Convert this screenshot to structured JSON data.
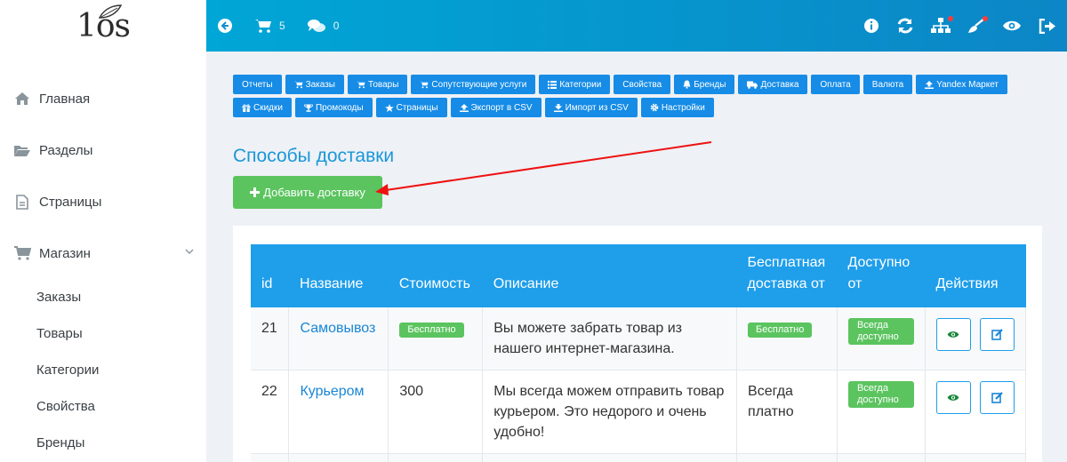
{
  "logo": {
    "text": "1os"
  },
  "topbar": {
    "cart_count": "5",
    "comments_count": "0"
  },
  "sidebar": {
    "items": [
      {
        "label": "Главная",
        "icon": "home-icon"
      },
      {
        "label": "Разделы",
        "icon": "folder-open-icon"
      },
      {
        "label": "Страницы",
        "icon": "file-icon"
      },
      {
        "label": "Магазин",
        "icon": "cart-icon"
      }
    ],
    "subitems": [
      "Заказы",
      "Товары",
      "Категории",
      "Свойства",
      "Бренды"
    ]
  },
  "quicknav": [
    "Отчеты",
    "Заказы",
    "Товары",
    "Сопутствующие услуги",
    "Категории",
    "Свойства",
    "Бренды",
    "Доставка",
    "Оплата",
    "Валюта",
    "Yandex Маркет",
    "Скидки",
    "Промокоды",
    "Страницы",
    "Экспорт в CSV",
    "Импорт из CSV",
    "Настройки"
  ],
  "page": {
    "title": "Способы доставки",
    "add_label": "Добавить доставку"
  },
  "table": {
    "headers": [
      "id",
      "Название",
      "Стоимость",
      "Описание",
      "Бесплатная доставка от",
      "Доступно от",
      "Действия"
    ],
    "rows": [
      {
        "id": "21",
        "name": "Самовывоз",
        "cost_badge": "Бесплатно",
        "desc": "Вы можете забрать товар из нашего интернет-магазина.",
        "free_badge": "Бесплатно",
        "avail": "Всегда доступно"
      },
      {
        "id": "22",
        "name": "Курьером",
        "cost": "300",
        "desc": "Мы всегда можем отправить товар курьером. Это недорого и очень удобно!",
        "free_text": "Всегда платно",
        "avail": "Всегда доступно"
      }
    ]
  },
  "colors": {
    "topbar": "#0ea0d8",
    "primary": "#168ce6",
    "success": "#5bc45f",
    "link": "#1a86d6",
    "annotation": "#e11"
  }
}
